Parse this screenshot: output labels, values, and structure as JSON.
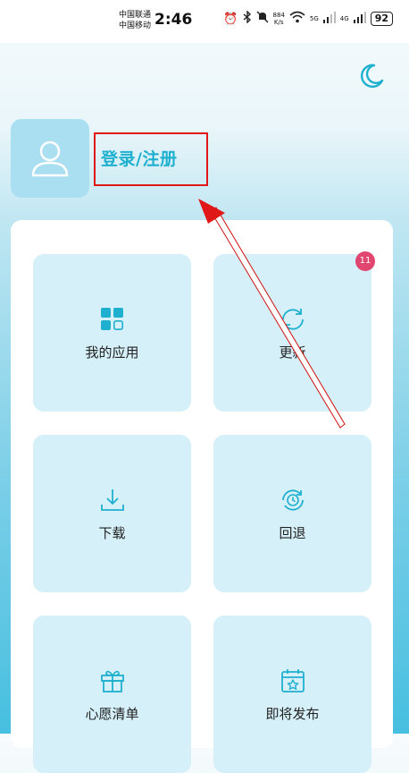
{
  "status_bar": {
    "carrier_1": "中国联通",
    "carrier_2": "中国移动",
    "time": "2:46",
    "net_speed_value": "884",
    "net_speed_unit": "K/s",
    "signal_1_label": "5G",
    "signal_2_label": "4G",
    "battery": "92"
  },
  "header": {
    "theme_icon": "moon-icon",
    "avatar_icon": "user-icon",
    "login_label": "登录/注册"
  },
  "grid": {
    "items": [
      {
        "label": "我的应用",
        "icon": "apps-grid-icon"
      },
      {
        "label": "更新",
        "icon": "refresh-icon",
        "badge": "11"
      },
      {
        "label": "下载",
        "icon": "download-icon"
      },
      {
        "label": "回退",
        "icon": "rollback-clock-icon"
      },
      {
        "label": "心愿清单",
        "icon": "gift-icon"
      },
      {
        "label": "即将发布",
        "icon": "calendar-star-icon"
      }
    ]
  },
  "colors": {
    "accent": "#1fb0cf",
    "tile_bg": "#d5f0f8",
    "badge": "#e0466f",
    "annotation_red": "#e01818"
  }
}
